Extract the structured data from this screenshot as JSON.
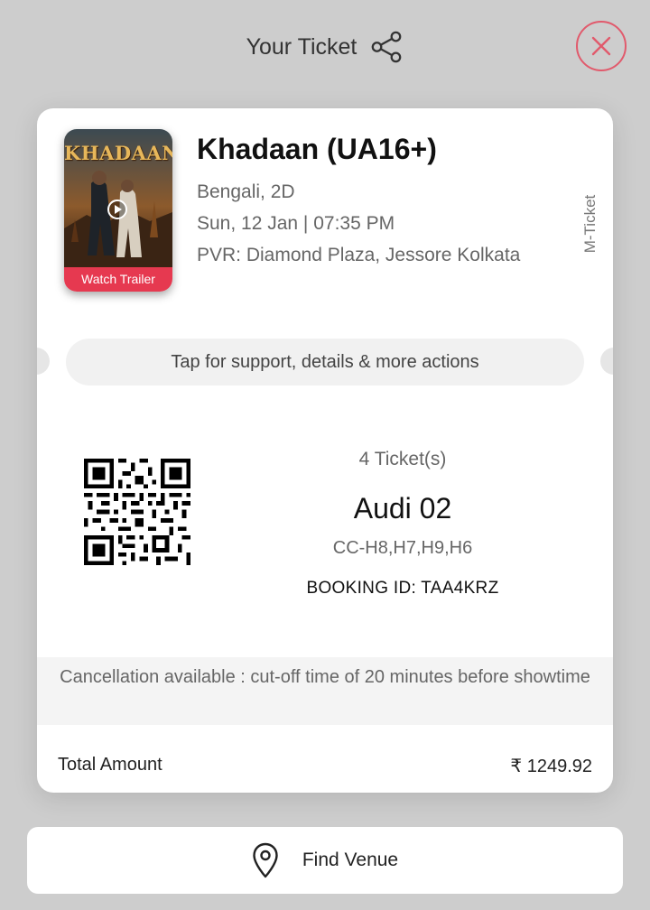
{
  "header": {
    "title": "Your Ticket",
    "share_icon": "share-icon",
    "close_icon": "close-icon"
  },
  "movie": {
    "title": "Khadaan (UA16+)",
    "language_format": "Bengali, 2D",
    "datetime": "Sun, 12 Jan | 07:35 PM",
    "venue": "PVR: Diamond Plaza, Jessore Kolkata",
    "poster_title": "KHADAAN",
    "trailer_label": "Watch Trailer"
  },
  "ticket_type": "M-Ticket",
  "support_label": "Tap for support, details & more actions",
  "booking": {
    "ticket_count": "4 Ticket(s)",
    "screen": "Audi 02",
    "seats": "CC-H8,H7,H9,H6",
    "booking_id": "BOOKING ID: TAA4KRZ"
  },
  "cancellation_note": "Cancellation available : cut-off time of 20 minutes before showtime",
  "total": {
    "label": "Total Amount",
    "value": "₹ 1249.92"
  },
  "find_venue_label": "Find Venue",
  "colors": {
    "accent": "#e63950",
    "close": "#e15a6c",
    "background": "#cdcdcd"
  }
}
